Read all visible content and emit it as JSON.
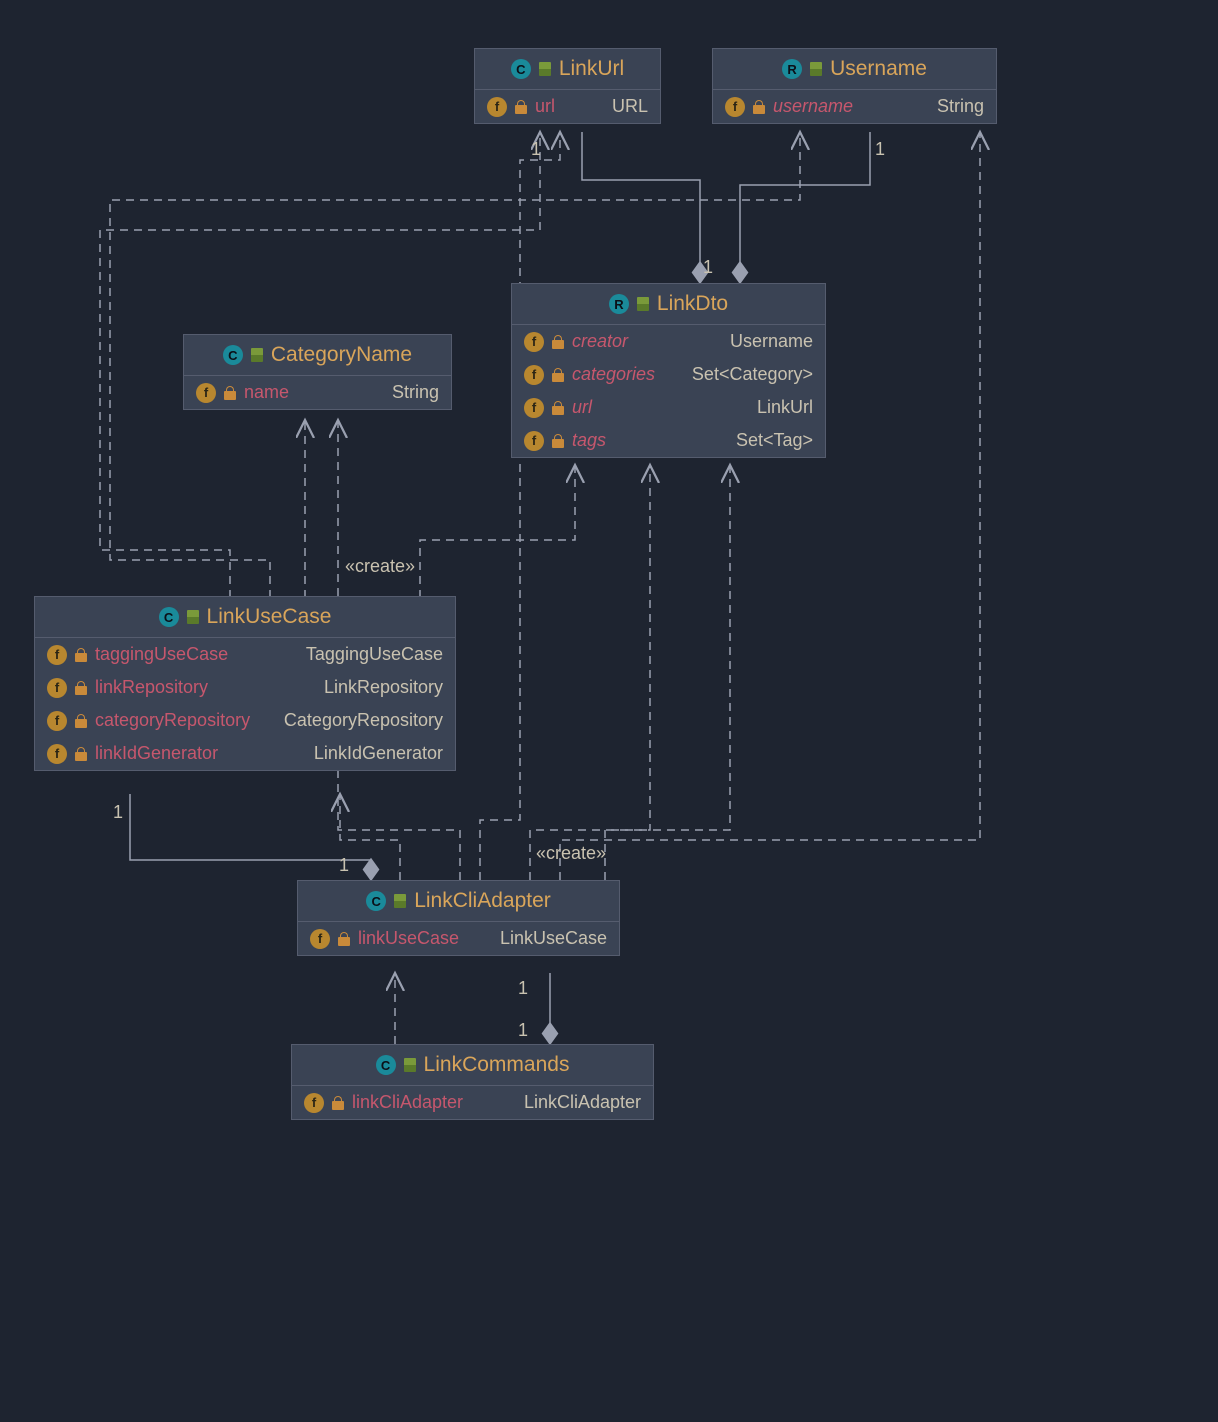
{
  "classes": {
    "link_url": {
      "title": "LinkUrl",
      "kind": "C",
      "attrs": [
        {
          "name": "url",
          "type": "URL",
          "italic": false
        }
      ]
    },
    "username": {
      "title": "Username",
      "kind": "R",
      "attrs": [
        {
          "name": "username",
          "type": "String",
          "italic": true
        }
      ]
    },
    "category_name": {
      "title": "CategoryName",
      "kind": "C",
      "attrs": [
        {
          "name": "name",
          "type": "String",
          "italic": false
        }
      ]
    },
    "link_dto": {
      "title": "LinkDto",
      "kind": "R",
      "attrs": [
        {
          "name": "creator",
          "type": "Username",
          "italic": true
        },
        {
          "name": "categories",
          "type": "Set<Category>",
          "italic": true
        },
        {
          "name": "url",
          "type": "LinkUrl",
          "italic": true
        },
        {
          "name": "tags",
          "type": "Set<Tag>",
          "italic": true
        }
      ]
    },
    "link_use_case": {
      "title": "LinkUseCase",
      "kind": "C",
      "attrs": [
        {
          "name": "taggingUseCase",
          "type": "TaggingUseCase",
          "italic": false
        },
        {
          "name": "linkRepository",
          "type": "LinkRepository",
          "italic": false
        },
        {
          "name": "categoryRepository",
          "type": "CategoryRepository",
          "italic": false
        },
        {
          "name": "linkIdGenerator",
          "type": "LinkIdGenerator",
          "italic": false
        }
      ]
    },
    "link_cli_adapter": {
      "title": "LinkCliAdapter",
      "kind": "C",
      "attrs": [
        {
          "name": "linkUseCase",
          "type": "LinkUseCase",
          "italic": false
        }
      ]
    },
    "link_commands": {
      "title": "LinkCommands",
      "kind": "C",
      "attrs": [
        {
          "name": "linkCliAdapter",
          "type": "LinkCliAdapter",
          "italic": false
        }
      ]
    }
  },
  "labels": {
    "mult_1_a": "1",
    "mult_1_b": "1",
    "mult_1_c": "1",
    "mult_1_d": "1",
    "mult_1_e": "1",
    "mult_1_f": "1",
    "mult_1_g": "1",
    "create_1": "«create»",
    "create_2": "«create»"
  },
  "connections": [
    {
      "from": "LinkDto",
      "to": "Username",
      "type": "aggregation",
      "multiplicity": "1"
    },
    {
      "from": "LinkDto",
      "to": "LinkUrl",
      "type": "aggregation",
      "multiplicity": "1"
    },
    {
      "from": "LinkUseCase",
      "to": "LinkUrl",
      "type": "dependency"
    },
    {
      "from": "LinkUseCase",
      "to": "Username",
      "type": "dependency"
    },
    {
      "from": "LinkUseCase",
      "to": "CategoryName",
      "type": "dependency"
    },
    {
      "from": "LinkUseCase",
      "to": "LinkDto",
      "type": "dependency",
      "stereotype": "create"
    },
    {
      "from": "LinkCliAdapter",
      "to": "LinkUseCase",
      "type": "aggregation",
      "multiplicity": "1"
    },
    {
      "from": "LinkCliAdapter",
      "to": "LinkUseCase",
      "type": "dependency"
    },
    {
      "from": "LinkCliAdapter",
      "to": "CategoryName",
      "type": "dependency"
    },
    {
      "from": "LinkCliAdapter",
      "to": "LinkUrl",
      "type": "dependency"
    },
    {
      "from": "LinkCliAdapter",
      "to": "Username",
      "type": "dependency"
    },
    {
      "from": "LinkCliAdapter",
      "to": "LinkDto",
      "type": "dependency",
      "stereotype": "create"
    },
    {
      "from": "LinkCommands",
      "to": "LinkCliAdapter",
      "type": "aggregation",
      "multiplicity": "1"
    },
    {
      "from": "LinkCommands",
      "to": "LinkCliAdapter",
      "type": "dependency"
    }
  ]
}
